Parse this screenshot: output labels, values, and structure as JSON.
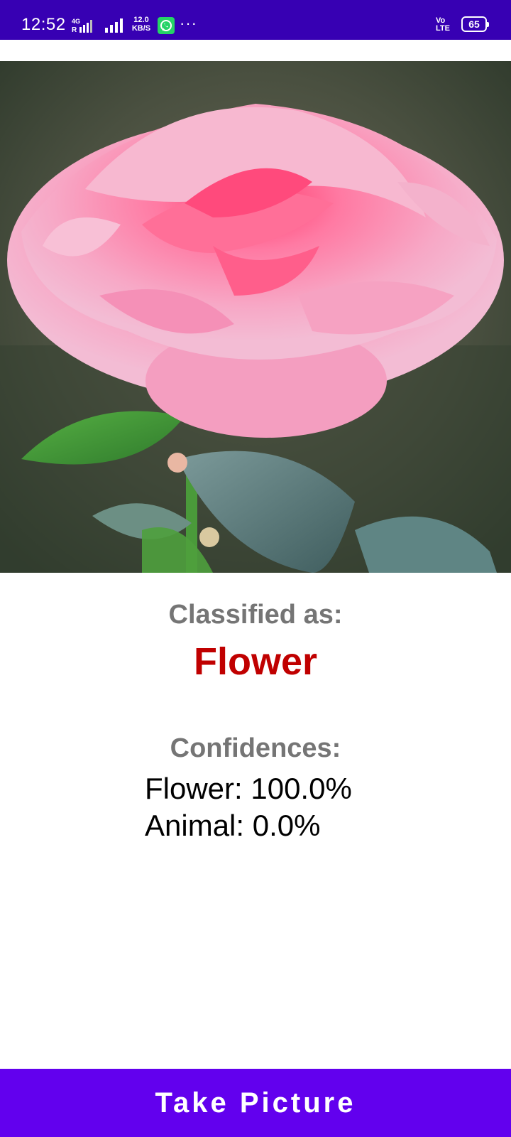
{
  "status_bar": {
    "time": "12:52",
    "net_type_top": "4G",
    "net_type_bottom": "R",
    "speed_value": "12.0",
    "speed_unit": "KB/S",
    "more": "···",
    "volte_top": "Vo",
    "volte_bottom": "LTE",
    "battery": "65",
    "icons": [
      "data-signal-icon",
      "cell-signal-icon",
      "whatsapp-icon",
      "battery-icon"
    ]
  },
  "photo": {
    "icon": "rose-photo"
  },
  "result": {
    "classified_label": "Classified as:",
    "classified_value": "Flower",
    "confidences_label": "Confidences:",
    "confidences": [
      {
        "text": "Flower: 100.0%"
      },
      {
        "text": "Animal: 0.0%"
      }
    ]
  },
  "button": {
    "label": "Take Picture"
  },
  "colors": {
    "status_bar": "#3700b3",
    "button": "#6200ee",
    "classified_value": "#c00000",
    "label_gray": "#757575"
  }
}
